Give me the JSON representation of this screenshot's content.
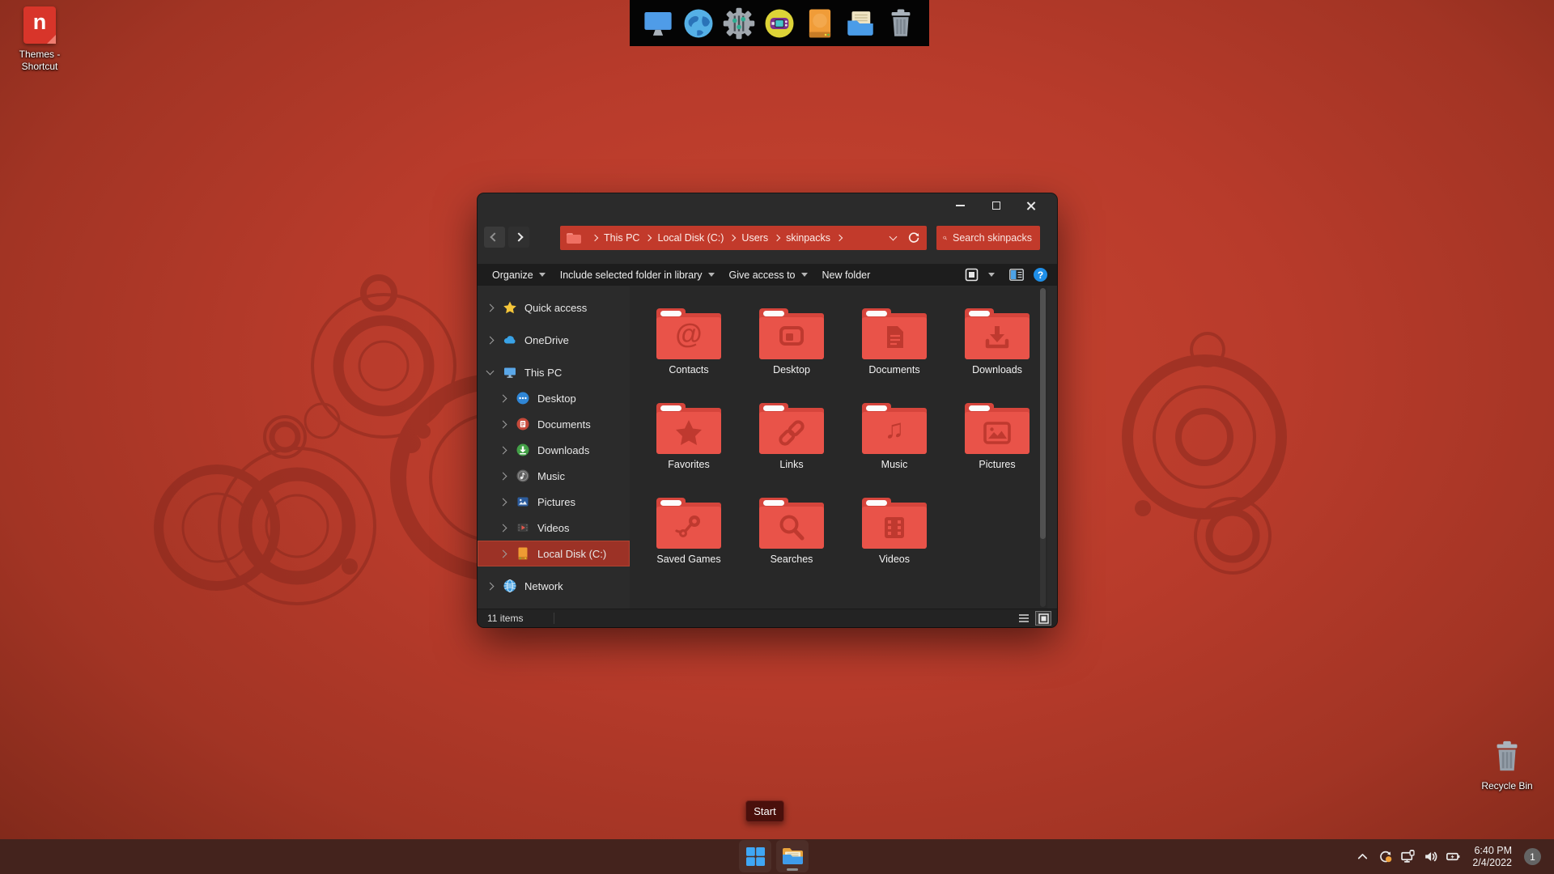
{
  "desktop": {
    "shortcut": {
      "label": "Themes - Shortcut",
      "glyph": "n"
    },
    "recycle_bin": {
      "label": "Recycle Bin"
    },
    "dock_icons": [
      "display",
      "globe",
      "settings",
      "games",
      "drive",
      "file-manager",
      "trash"
    ]
  },
  "window": {
    "address": {
      "segments": [
        {
          "label": "This PC"
        },
        {
          "label": "Local Disk (C:)"
        },
        {
          "label": "Users"
        },
        {
          "label": "skinpacks"
        }
      ]
    },
    "search": {
      "placeholder": "Search skinpacks"
    },
    "toolbar": [
      {
        "label": "Organize"
      },
      {
        "label": "Include selected folder in library"
      },
      {
        "label": "Give access to"
      },
      {
        "label": "New folder"
      }
    ],
    "help_glyph": "?",
    "sidebar": [
      {
        "label": "Quick access"
      },
      {
        "label": "OneDrive"
      },
      {
        "label": "This PC"
      },
      {
        "label": "Desktop"
      },
      {
        "label": "Documents"
      },
      {
        "label": "Downloads"
      },
      {
        "label": "Music"
      },
      {
        "label": "Pictures"
      },
      {
        "label": "Videos"
      },
      {
        "label": "Local Disk (C:)"
      },
      {
        "label": "Network"
      }
    ],
    "files": [
      "Contacts",
      "Desktop",
      "Documents",
      "Downloads",
      "Favorites",
      "Links",
      "Music",
      "Pictures",
      "Saved Games",
      "Searches",
      "Videos"
    ],
    "glyph_at": "@",
    "glyph_music": "♫",
    "status": {
      "items_text": "11 items"
    }
  },
  "taskbar": {
    "start_tooltip": "Start",
    "tray_icons": [
      "hidden-icons",
      "sync",
      "network-display",
      "volume",
      "battery"
    ],
    "clock": {
      "time": "6:40 PM",
      "date": "2/4/2022"
    },
    "notification_badge": "1"
  },
  "colors": {
    "desktop_red": "#b83b2b",
    "address_red": "#c23a2b",
    "folder_red": "#e95349",
    "selection_red": "#9c3226",
    "taskbar_brown": "#44231d",
    "window_gray": "#2b2b2b"
  }
}
